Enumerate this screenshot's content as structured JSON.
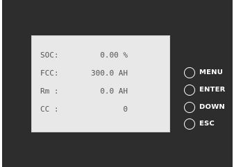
{
  "display": {
    "rows": [
      {
        "label": "SOC:",
        "value": "0.00 %"
      },
      {
        "label": "FCC:",
        "value": "300.0 AH"
      },
      {
        "label": "Rm :",
        "value": "0.0 AH"
      },
      {
        "label": "CC :",
        "value": "0"
      }
    ]
  },
  "buttons": [
    {
      "label": "MENU"
    },
    {
      "label": "ENTER"
    },
    {
      "label": "DOWN"
    },
    {
      "label": "ESC"
    }
  ],
  "colors": {
    "panel": "#2d2d2d",
    "screen": "#e8e8e8",
    "screen_text": "#555555",
    "button_outline": "#ffffff"
  }
}
